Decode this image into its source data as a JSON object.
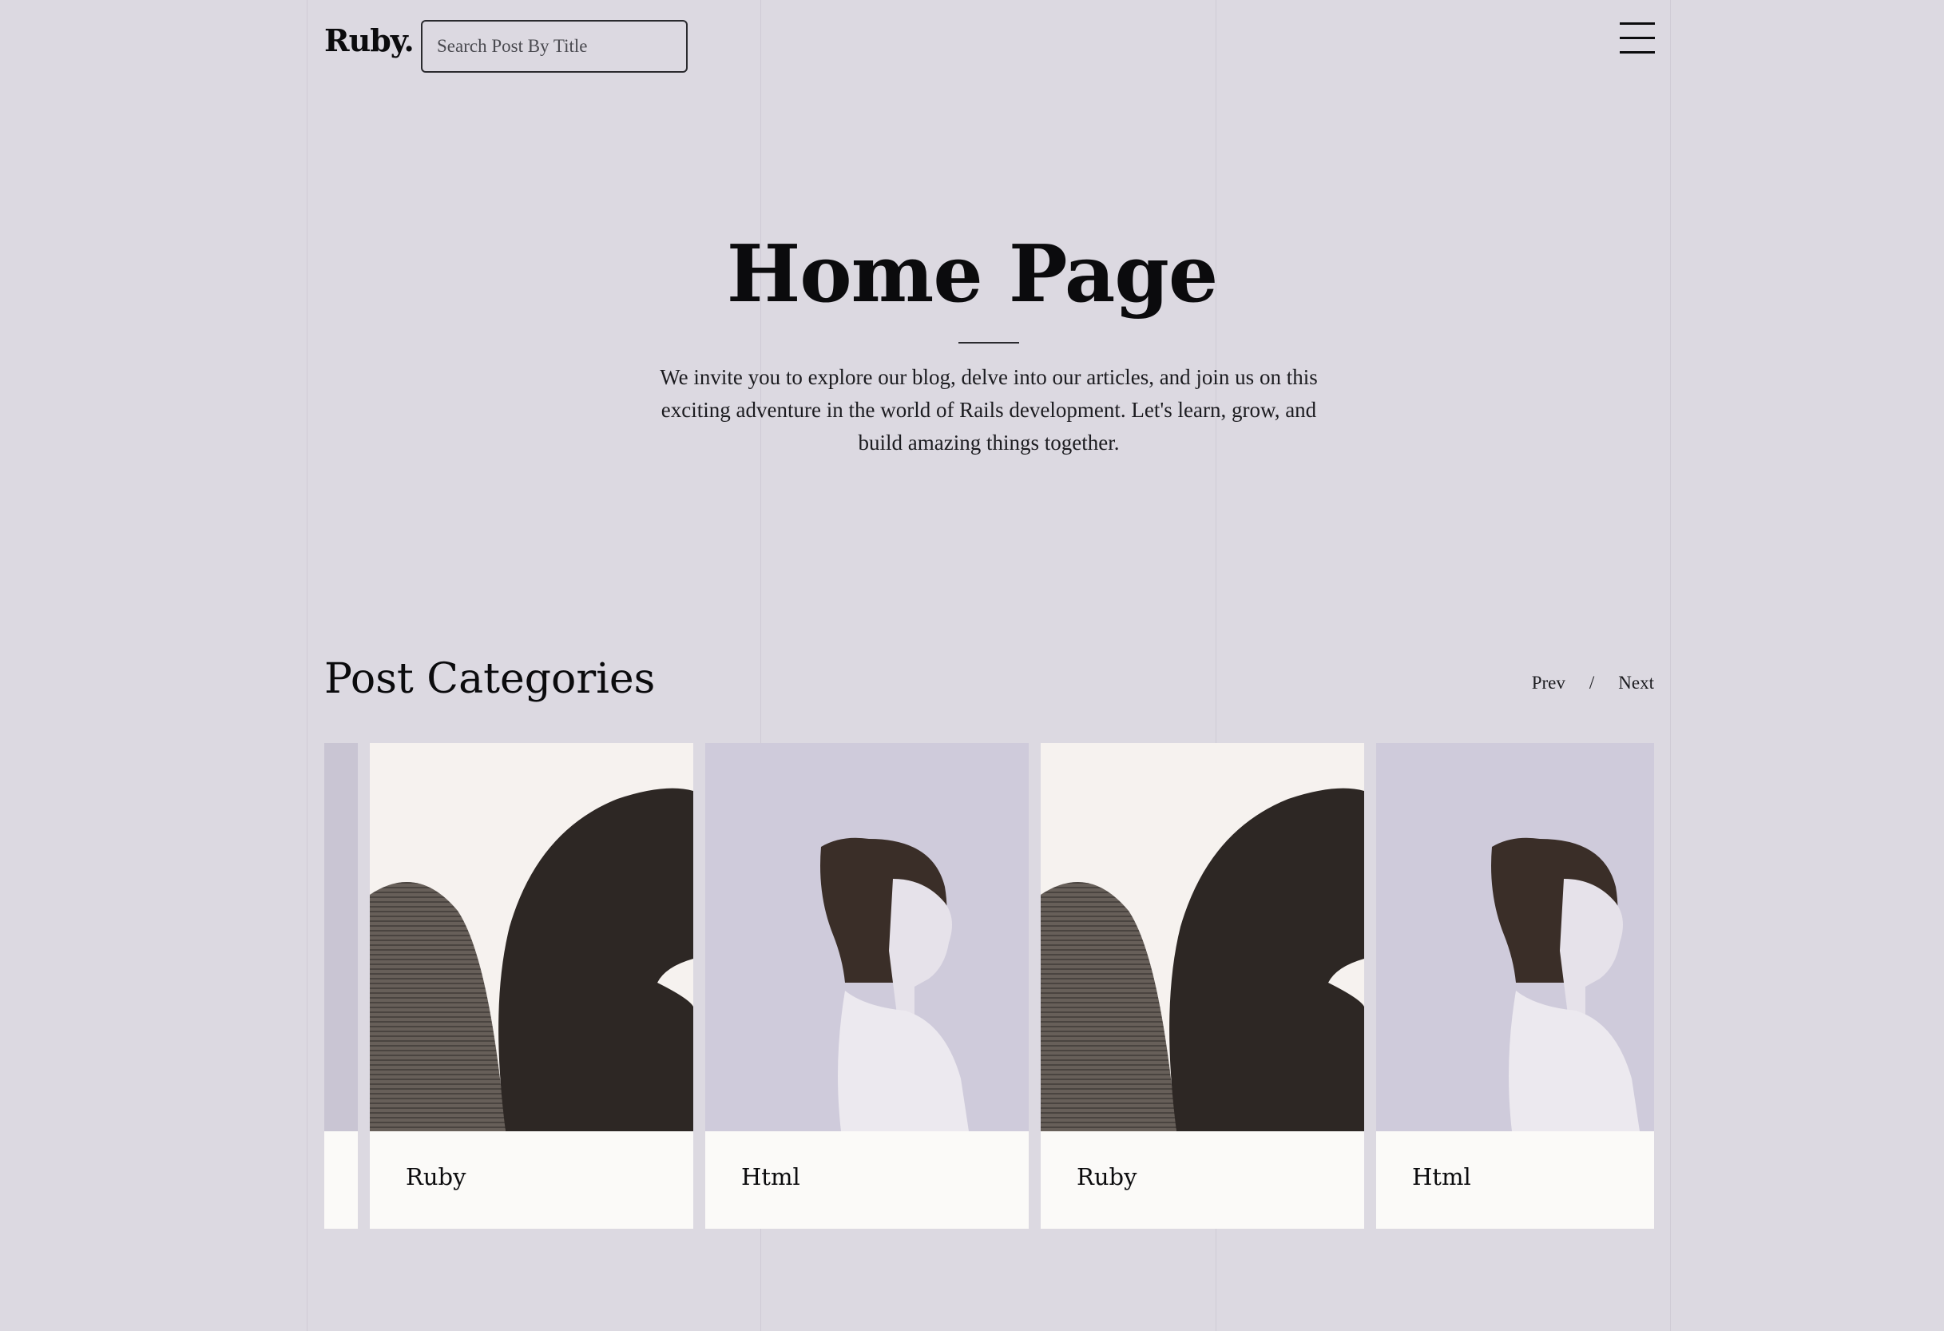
{
  "header": {
    "logo": "Ruby.",
    "search_placeholder": "Search Post By Title",
    "menu_icon": "hamburger-menu-icon"
  },
  "hero": {
    "title": "Home Page",
    "description": "We invite you to explore our blog, delve into our articles, and join us on this exciting adventure in the world of Rails development. Let's learn, grow, and build amazing things together."
  },
  "categories": {
    "title": "Post Categories",
    "prev_label": "Prev",
    "separator": "/",
    "next_label": "Next",
    "cards": [
      {
        "label": "Ruby",
        "image": "sculpture"
      },
      {
        "label": "Html",
        "image": "portrait"
      },
      {
        "label": "Ruby",
        "image": "sculpture"
      },
      {
        "label": "Html",
        "image": "portrait"
      }
    ]
  },
  "colors": {
    "background": "#dcd9e1",
    "text": "#0b0b0d",
    "card_background": "#fbfaf8"
  }
}
